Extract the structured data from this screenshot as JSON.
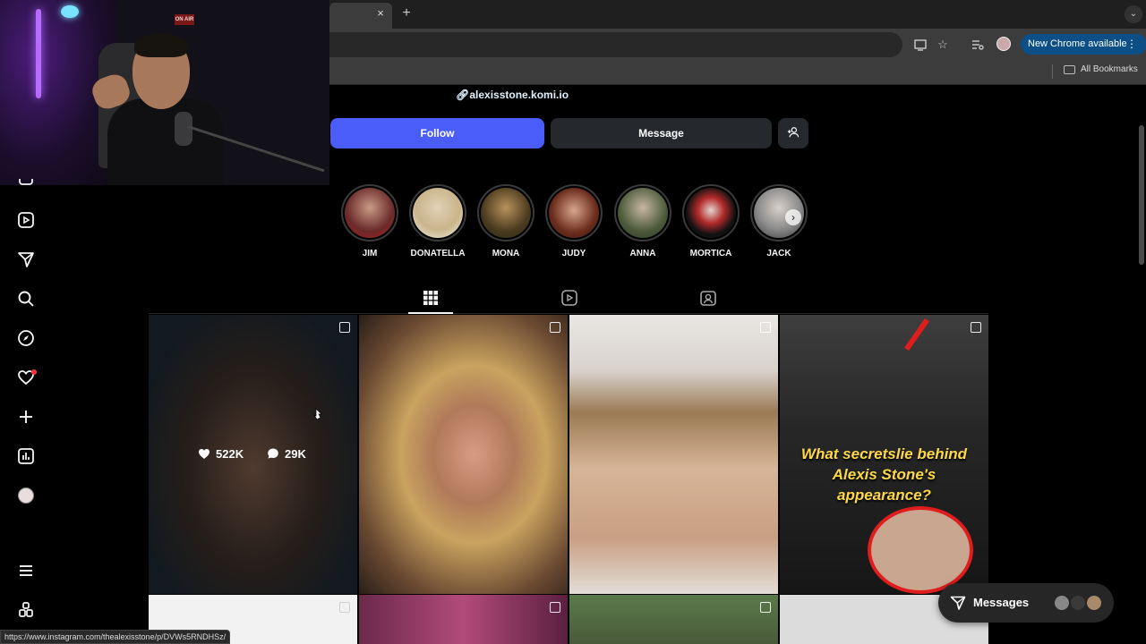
{
  "browser": {
    "tab_close": "×",
    "tab_new": "+",
    "new_chrome_label": "New Chrome available",
    "bookmarks_label": "All Bookmarks",
    "status_url": "https://www.instagram.com/thealexisstone/p/DVWs5RNDHSz/"
  },
  "webcam": {
    "sign_text": "ON AIR"
  },
  "profile": {
    "link_text": "alexisstone.komi.io",
    "follow_label": "Follow",
    "message_label": "Message",
    "add_user_icon": "add-user-icon"
  },
  "highlights": [
    {
      "label": "JIM",
      "color": "#8a2020"
    },
    {
      "label": "DONATELLA",
      "color": "#d9c9a0"
    },
    {
      "label": "MONA",
      "color": "#5a4a2a"
    },
    {
      "label": "JUDY",
      "color": "#7a4030"
    },
    {
      "label": "ANNA",
      "color": "#6a7a5a"
    },
    {
      "label": "MORTICA",
      "color": "#222222"
    },
    {
      "label": "JACK",
      "color": "#8a8a8a"
    }
  ],
  "posts": {
    "post1": {
      "likes": "522K",
      "comments": "29K"
    },
    "post4": {
      "caption_line1": "What secretslie behind",
      "caption_line2": "Alexis Stone's",
      "caption_line3": "appearance?"
    }
  },
  "messages": {
    "label": "Messages"
  },
  "colors": {
    "accent": "#4a5df9",
    "background": "#000000",
    "secondary_button": "#25292e",
    "chrome_badge": "#0b4f86"
  }
}
